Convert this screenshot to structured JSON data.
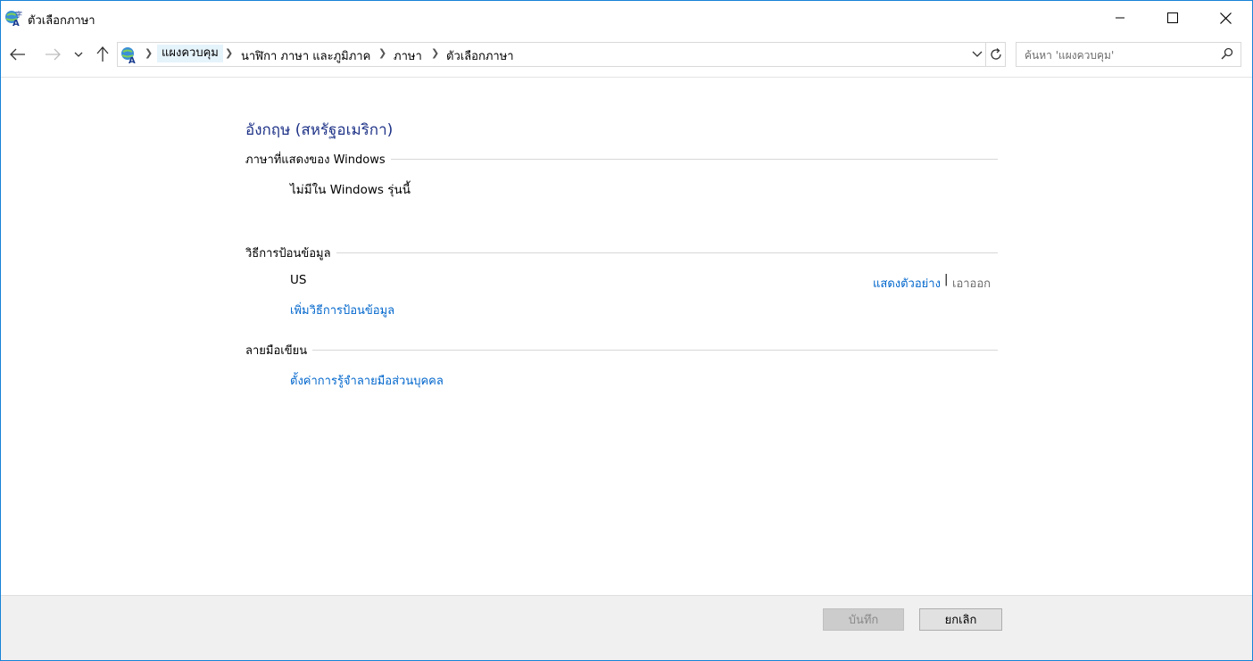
{
  "window": {
    "title": "ตัวเลือกภาษา"
  },
  "address": {
    "breadcrumb": [
      "แผงควบคุม",
      "นาฬิกา ภาษา และภูมิภาค",
      "ภาษา",
      "ตัวเลือกภาษา"
    ]
  },
  "search": {
    "placeholder": "ค้นหา 'แผงควบคุม'"
  },
  "content": {
    "language_title": "อังกฤษ (สหรัฐอเมริกา)",
    "display_language": {
      "heading": "ภาษาที่แสดงของ Windows",
      "value": "ไม่มีใน Windows รุ่นนี้"
    },
    "input_method": {
      "heading": "วิธีการป้อนข้อมูล",
      "item": "US",
      "preview_link": "แสดงตัวอย่าง",
      "separator": "|",
      "remove_link": "เอาออก",
      "add_link": "เพิ่มวิธีการป้อนข้อมูล"
    },
    "handwriting": {
      "heading": "ลายมือเขียน",
      "personalize_link": "ตั้งค่าการรู้จำลายมือส่วนบุคคล"
    }
  },
  "footer": {
    "save_label": "บันทึก",
    "cancel_label": "ยกเลิก"
  }
}
